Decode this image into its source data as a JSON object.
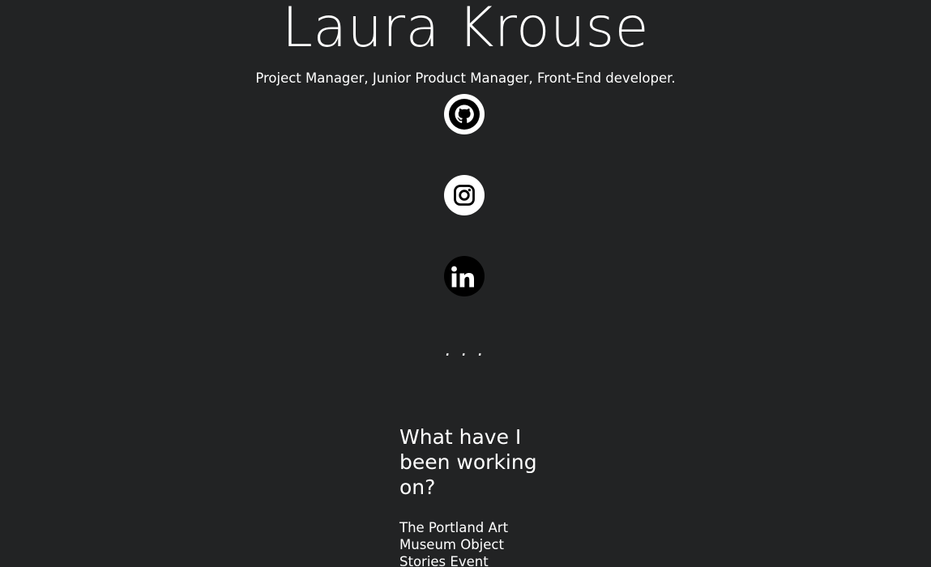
{
  "header": {
    "name": "Laura Krouse",
    "tagline": "Project Manager, Junior Product Manager, Front-End developer."
  },
  "social": [
    {
      "network": "GitHub",
      "icon": "github-icon"
    },
    {
      "network": "Instagram",
      "icon": "instagram-icon"
    },
    {
      "network": "LinkedIn",
      "icon": "linkedin-icon"
    }
  ],
  "divider": ". . .",
  "work": {
    "heading": "What have I been working on?",
    "projects": [
      {
        "title": "The Portland Art Museum Object Stories Event"
      }
    ]
  },
  "colors": {
    "background": "#222324",
    "text": "#ffffff",
    "icon_light": "#ffffff",
    "icon_dark": "#000000"
  }
}
